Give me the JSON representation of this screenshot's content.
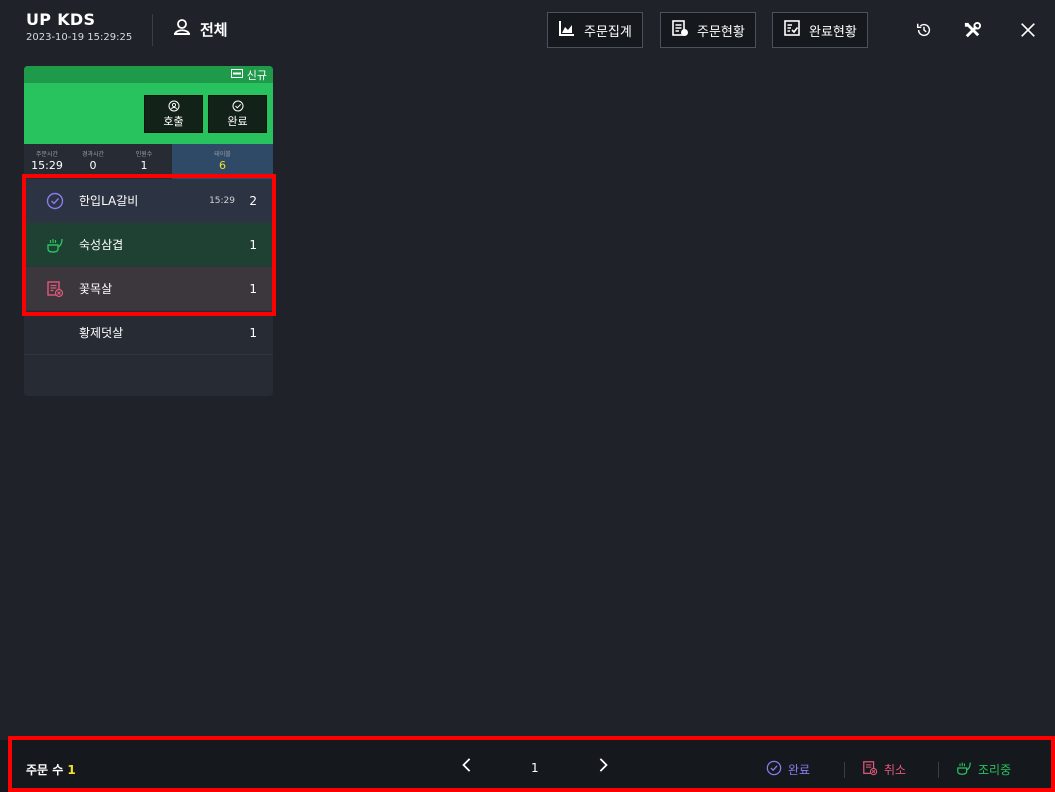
{
  "header": {
    "app_name": "UP KDS",
    "datetime": "2023-10-19 15:29:25",
    "scope_label": "전체",
    "buttons": {
      "order_summary": "주문집계",
      "order_status": "주문현황",
      "completed_status": "완료현황"
    },
    "icons": [
      "chart-icon",
      "order-list-icon",
      "checklist-icon",
      "history-icon",
      "tools-icon",
      "close-icon"
    ]
  },
  "card": {
    "badge": "신규",
    "call_label": "호출",
    "complete_label": "완료",
    "stats": [
      {
        "label": "주문시간",
        "value": "15:29"
      },
      {
        "label": "경과시간",
        "value": "0"
      },
      {
        "label": "인원수",
        "value": "1"
      },
      {
        "label": "테이블",
        "value": "6"
      }
    ],
    "items": [
      {
        "name": "한입LA갈비",
        "time": "15:29",
        "qty": "2",
        "status": "complete"
      },
      {
        "name": "숙성삼겹",
        "time": "",
        "qty": "1",
        "status": "cooking"
      },
      {
        "name": "꽃목살",
        "time": "",
        "qty": "1",
        "status": "cancel"
      },
      {
        "name": "황제덧살",
        "time": "",
        "qty": "1",
        "status": "normal"
      }
    ],
    "colors": {
      "header_green": "#28c35f",
      "band_green": "#1e9a4a",
      "table_blue": "#2f4a66"
    }
  },
  "footer": {
    "order_count_label": "주문 수",
    "order_count": "1",
    "page": "1",
    "prev_icon": "chevron-left-icon",
    "next_icon": "chevron-right-icon",
    "legend": {
      "complete": "완료",
      "cancel": "취소",
      "cooking": "조리중"
    },
    "colors": {
      "complete": "#8a7cf0",
      "cancel": "#e0587a",
      "cooking": "#27c35f",
      "count": "#f2e02a"
    }
  }
}
